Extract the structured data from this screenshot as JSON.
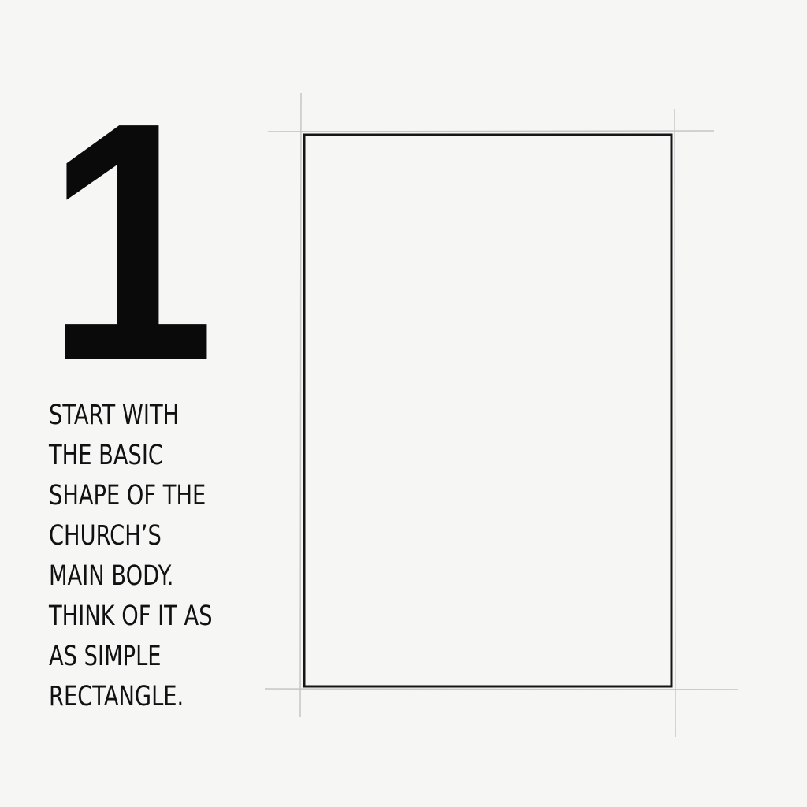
{
  "step": {
    "number": "1",
    "instruction_lines": [
      "START WITH",
      "THE BASIC",
      "SHAPE OF THE",
      "CHURCH’S",
      "MAIN BODY.",
      "THINK OF IT AS",
      "AS SIMPLE",
      "RECTANGLE."
    ]
  },
  "colors": {
    "background": "#f6f6f5",
    "ink": "#111111",
    "guide": "#c8c8c8"
  }
}
